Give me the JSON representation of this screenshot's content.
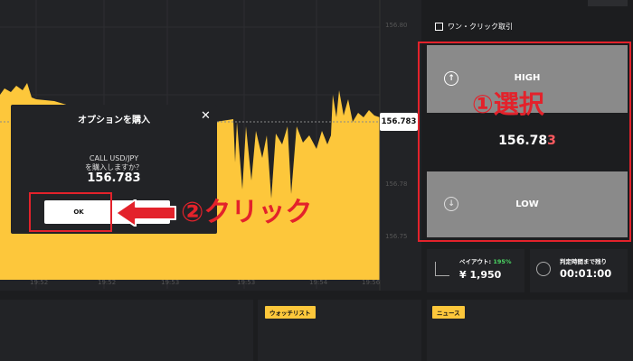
{
  "chart": {
    "current_price": "156.783",
    "price_ticks": [
      "156.80",
      "156.78",
      "156.75"
    ],
    "time_ticks": [
      "19:52",
      "19:52",
      "19:53",
      "19:53",
      "19:54",
      "19:56"
    ]
  },
  "modal": {
    "title": "オプションを購入",
    "close": "✕",
    "asset_line": "CALL USD/JPY",
    "confirm_line": "を購入しますか？",
    "price": "156.783",
    "ok_label": "OK"
  },
  "annotations": {
    "step1": "①選択",
    "step2": "②クリック"
  },
  "trade_panel": {
    "one_click_label": "ワン・クリック取引",
    "high_label": "HIGH",
    "low_label": "LOW",
    "price_main": "156.78",
    "price_last_digit": "3",
    "payout_title": "ペイアウト:",
    "payout_pct": "195%",
    "payout_value": "¥ 1,950",
    "timer_title": "判定時間まで残り",
    "timer_value": "00:01:00"
  },
  "bottom": {
    "watchlist_tag": "ウォッチリスト",
    "news_tag": "ニュース"
  },
  "colors": {
    "chart_fill": "#fdc73b",
    "highlight_red": "#e3222b",
    "button_gray": "#8a8a8a",
    "accent_green": "#4cd964"
  }
}
